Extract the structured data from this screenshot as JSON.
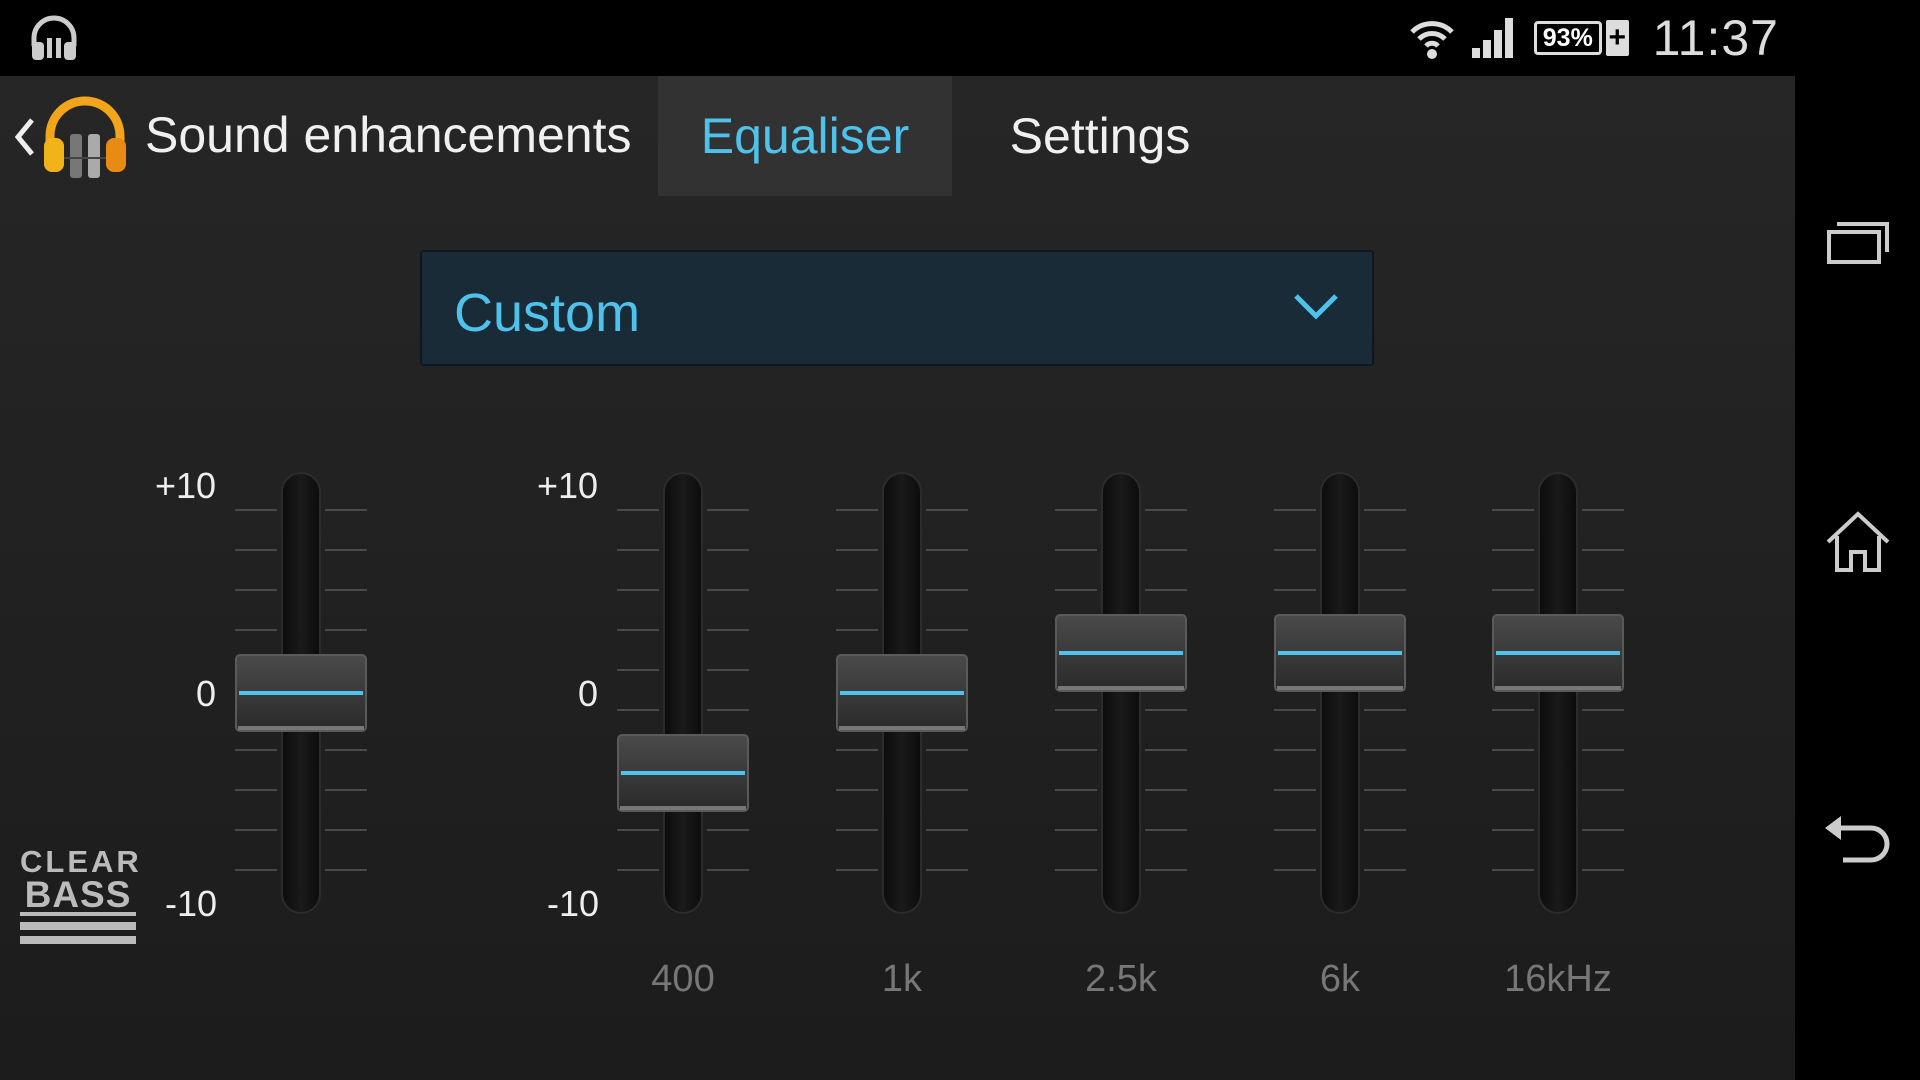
{
  "status_bar": {
    "battery_percent": "93%",
    "battery_charging_icon": "plus-icon",
    "time": "11:37",
    "icons": [
      "headphones-icon",
      "wifi-icon",
      "signal-icon",
      "battery-icon"
    ]
  },
  "action_bar": {
    "title": "Sound enhancements",
    "tabs": [
      {
        "label": "Equaliser",
        "selected": true
      },
      {
        "label": "Settings",
        "selected": false
      }
    ]
  },
  "preset": {
    "value": "Custom"
  },
  "clear_bass": {
    "logo_text_top": "CLEAR",
    "logo_text_bottom": "BASS",
    "scale_max": "+10",
    "scale_zero": "0",
    "scale_min": "-10",
    "level": 0
  },
  "equalizer": {
    "scale_max": "+10",
    "scale_zero": "0",
    "scale_min": "-10",
    "bands": [
      {
        "label": "400",
        "level": -4
      },
      {
        "label": "1k",
        "level": 0
      },
      {
        "label": "2.5k",
        "level": 2
      },
      {
        "label": "6k",
        "level": 2
      },
      {
        "label": "16kHz",
        "level": 2
      }
    ]
  },
  "colors": {
    "accent": "#4fc2ec",
    "background": "#1e1e1e",
    "dropdown_bg": "#1a2b38"
  },
  "nav_bar": {
    "buttons": [
      "recent-apps-icon",
      "home-icon",
      "back-icon"
    ]
  }
}
